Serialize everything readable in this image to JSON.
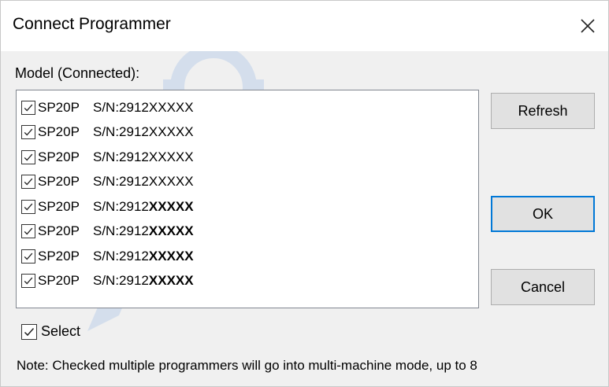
{
  "window": {
    "title": "Connect Programmer",
    "close_icon": "close-icon"
  },
  "model_label": "Model (Connected):",
  "programmers": [
    {
      "checked": true,
      "model": "SP20P",
      "sn_prefix": "S/N:2912",
      "sn_mask": "XXXXX",
      "mask_bold": false
    },
    {
      "checked": true,
      "model": "SP20P",
      "sn_prefix": "S/N:2912",
      "sn_mask": "XXXXX",
      "mask_bold": false
    },
    {
      "checked": true,
      "model": "SP20P",
      "sn_prefix": "S/N:2912",
      "sn_mask": "XXXXX",
      "mask_bold": false
    },
    {
      "checked": true,
      "model": "SP20P",
      "sn_prefix": "S/N:2912",
      "sn_mask": "XXXXX",
      "mask_bold": false
    },
    {
      "checked": true,
      "model": "SP20P",
      "sn_prefix": "S/N:2912",
      "sn_mask": "XXXXX",
      "mask_bold": true
    },
    {
      "checked": true,
      "model": "SP20P",
      "sn_prefix": "S/N:2912",
      "sn_mask": "XXXXX",
      "mask_bold": true
    },
    {
      "checked": true,
      "model": "SP20P",
      "sn_prefix": "S/N:2912",
      "sn_mask": "XXXXX",
      "mask_bold": true
    },
    {
      "checked": true,
      "model": "SP20P",
      "sn_prefix": "S/N:2912",
      "sn_mask": "XXXXX",
      "mask_bold": true
    }
  ],
  "buttons": {
    "refresh": "Refresh",
    "ok": "OK",
    "cancel": "Cancel"
  },
  "select_all": {
    "label": "Select",
    "checked": true
  },
  "note": "Note: Checked multiple programmers will go into multi-machine mode, up to 8",
  "colors": {
    "accent": "#0078d7",
    "dialog_bg": "#f0f0f0",
    "button_bg": "#e1e1e1",
    "watermark": "#1e6fd9"
  }
}
